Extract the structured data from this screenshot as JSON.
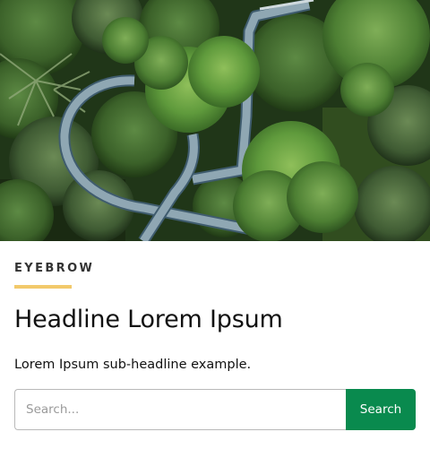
{
  "hero": {
    "image_description_icon": "canopy-walkway-image"
  },
  "eyebrow": "EYEBROW",
  "headline": "Headline Lorem Ipsum",
  "subheadline": "Lorem Ipsum sub-headline example.",
  "search": {
    "placeholder": "Search...",
    "value": "",
    "button_label": "Search"
  },
  "colors": {
    "accent_rule": "#f2c96b",
    "button_bg": "#098a4e",
    "input_border": "#b9b9b9"
  }
}
